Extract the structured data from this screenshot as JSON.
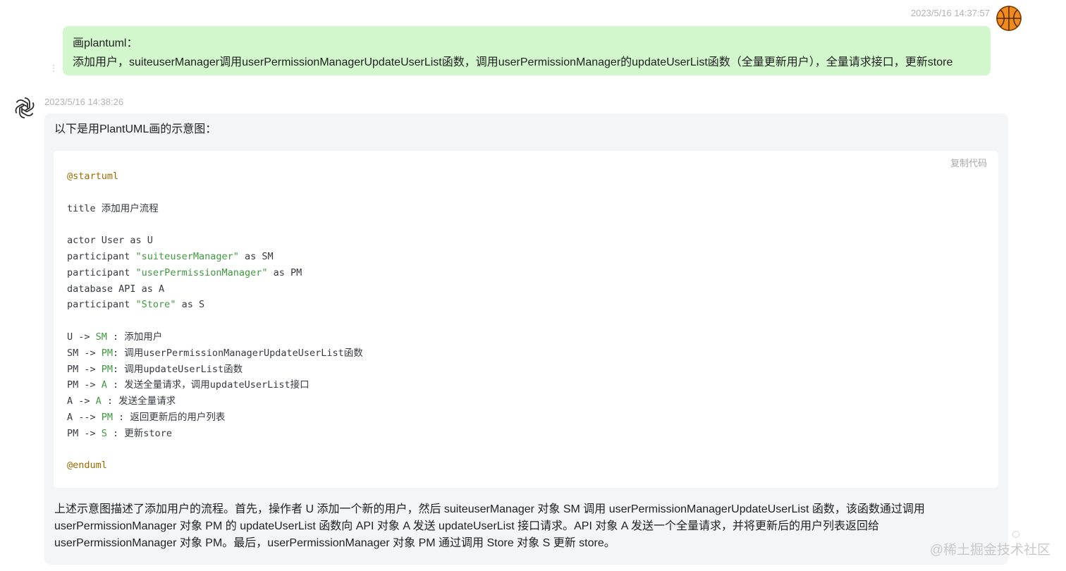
{
  "user_message": {
    "timestamp": "2023/5/16 14:37:57",
    "lines": [
      "画plantuml：",
      "添加用户，suiteuserManager调用userPermissionManagerUpdateUserList函数，调用userPermissionManager的updateUserList函数（全量更新用户），全量请求接口，更新store"
    ],
    "avatar_icon": "basketball-icon"
  },
  "bot_message": {
    "timestamp": "2023/5/16 14:38:26",
    "avatar_icon": "openai-logo-icon",
    "intro": "以下是用PlantUML画的示意图：",
    "copy_label": "复制代码",
    "code_lines": [
      [
        {
          "t": "@startuml",
          "c": "meta"
        }
      ],
      [],
      [
        {
          "t": "title 添加用户流程",
          "c": ""
        }
      ],
      [],
      [
        {
          "t": "actor User as U",
          "c": ""
        }
      ],
      [
        {
          "t": "participant ",
          "c": ""
        },
        {
          "t": "\"suiteuserManager\"",
          "c": "str"
        },
        {
          "t": " as SM",
          "c": ""
        }
      ],
      [
        {
          "t": "participant ",
          "c": ""
        },
        {
          "t": "\"userPermissionManager\"",
          "c": "str"
        },
        {
          "t": " as PM",
          "c": ""
        }
      ],
      [
        {
          "t": "database API as A",
          "c": ""
        }
      ],
      [
        {
          "t": "participant ",
          "c": ""
        },
        {
          "t": "\"Store\"",
          "c": "str"
        },
        {
          "t": " as S",
          "c": ""
        }
      ],
      [],
      [
        {
          "t": "U -> ",
          "c": ""
        },
        {
          "t": "SM",
          "c": "id"
        },
        {
          "t": " : 添加用户",
          "c": ""
        }
      ],
      [
        {
          "t": "SM -> ",
          "c": ""
        },
        {
          "t": "PM",
          "c": "id"
        },
        {
          "t": ": 调用userPermissionManagerUpdateUserList函数",
          "c": ""
        }
      ],
      [
        {
          "t": "PM -> ",
          "c": ""
        },
        {
          "t": "PM",
          "c": "id"
        },
        {
          "t": ": 调用updateUserList函数",
          "c": ""
        }
      ],
      [
        {
          "t": "PM -> ",
          "c": ""
        },
        {
          "t": "A",
          "c": "id"
        },
        {
          "t": " : 发送全量请求，调用updateUserList接口",
          "c": ""
        }
      ],
      [
        {
          "t": "A -> ",
          "c": ""
        },
        {
          "t": "A",
          "c": "id"
        },
        {
          "t": " : 发送全量请求",
          "c": ""
        }
      ],
      [
        {
          "t": "A --> ",
          "c": ""
        },
        {
          "t": "PM",
          "c": "id"
        },
        {
          "t": " : 返回更新后的用户列表",
          "c": ""
        }
      ],
      [
        {
          "t": "PM -> ",
          "c": ""
        },
        {
          "t": "S",
          "c": "id"
        },
        {
          "t": " : 更新store",
          "c": ""
        }
      ],
      [],
      [
        {
          "t": "@enduml",
          "c": "meta"
        }
      ]
    ],
    "summary_lines": [
      "上述示意图描述了添加用户的流程。首先，操作者 U 添加一个新的用户，然后 suiteuserManager 对象 SM 调用 userPermissionManagerUpdateUserList 函数，该函数通过调用",
      "userPermissionManager 对象 PM 的 updateUserList 函数向 API 对象 A 发送 updateUserList 接口请求。API 对象 A 发送一个全量请求，并将更新后的用户列表返回给",
      "userPermissionManager 对象 PM。最后，userPermissionManager 对象 PM 通过调用 Store 对象 S 更新 store。"
    ]
  },
  "watermark": "@稀土掘金技术社区",
  "colors": {
    "user_bubble": "#d2f7cc",
    "bot_bubble": "#f4f5f6",
    "code_string": "#3f9a3f",
    "code_meta": "#9c6b00"
  }
}
